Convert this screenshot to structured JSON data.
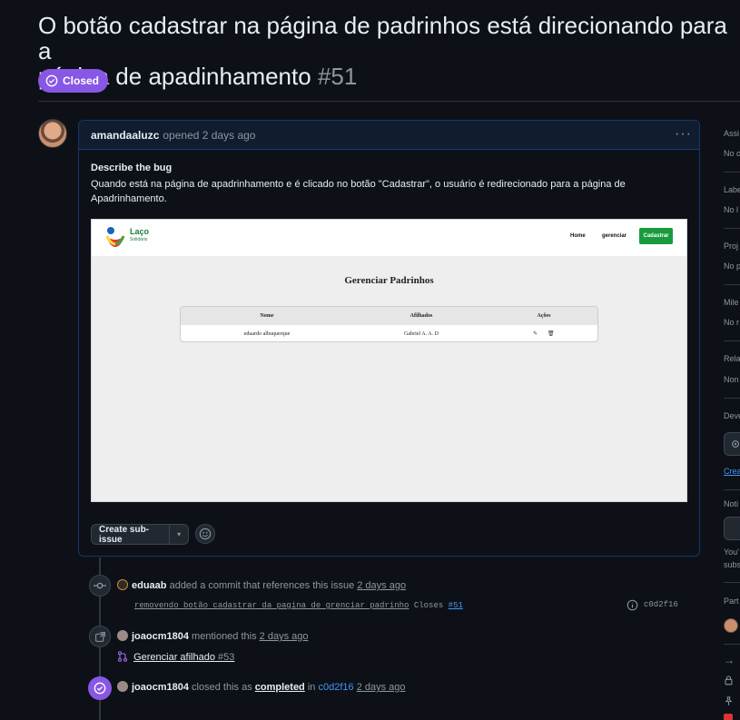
{
  "issue": {
    "title_line1": "O botão cadastrar na página de padrinhos está direcionando para a",
    "title_line2": "página de apadinhamento",
    "number": "#51",
    "state": "Closed"
  },
  "comment": {
    "author": "amandaaluzc",
    "meta": "opened 2 days ago",
    "kebab": "···",
    "heading": "Describe the bug",
    "body_line1": "Quando está na página de apadrinhamento e é clicado no botão \"Cadastrar\", o usuário é redirecionado para a página de",
    "body_line2": "Apadrinhamento.",
    "create_subissue_label": "Create sub-issue"
  },
  "screenshot": {
    "logo_word": "Laço",
    "logo_sub": "Solidário",
    "nav_home": "Home",
    "nav_gerenciar": "gerenciar",
    "nav_cadastrar": "Cadastrar",
    "heading": "Gerenciar Padrinhos",
    "columns": [
      "Nome",
      "Afilhados",
      "Ações"
    ],
    "row": [
      "eduardo albuquerque",
      "Gabriel A. A. D"
    ]
  },
  "timeline": [
    {
      "user": "eduaab",
      "action": "added a commit that references this issue",
      "time": "2 days ago",
      "commit_msg": "removendo botão cadastrar da pagina de grenciar padrinho",
      "closes": "Closes",
      "closes_ref": "#51",
      "sha": "c0d2f16"
    },
    {
      "user": "joaocm1804",
      "action": "mentioned this",
      "time": "2 days ago",
      "ref_title": "Gerenciar afilhado",
      "ref_num": "#53"
    },
    {
      "user": "joaocm1804",
      "action": "closed this as",
      "completed": "completed",
      "in": "in",
      "sha": "c0d2f16",
      "time": "2 days ago"
    }
  ],
  "sidebar": {
    "assignees": {
      "heading": "Assi",
      "value": "No o"
    },
    "labels": {
      "heading": "Labe",
      "value": "No l"
    },
    "projects": {
      "heading": "Proj",
      "value": "No p"
    },
    "milestone": {
      "heading": "Mile",
      "value": "No r"
    },
    "relationships": {
      "heading": "Rela",
      "value": "Non"
    },
    "development": {
      "heading": "Deve",
      "link": "Crea"
    },
    "notifications": {
      "heading": "Noti",
      "text1": "You'",
      "text2": "subs"
    },
    "participants": {
      "heading": "Part"
    }
  },
  "colors": {
    "background": "#0d1117",
    "closed_badge": "#8957e5",
    "link": "#4493f8",
    "cadastrar_button": "#1a9a3f"
  }
}
